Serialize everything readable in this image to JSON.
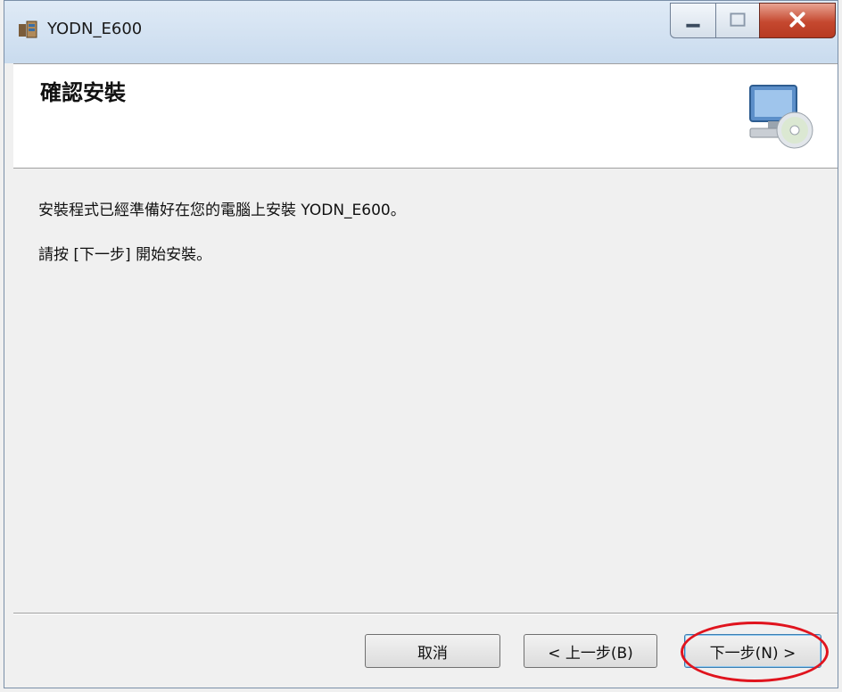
{
  "window": {
    "title": "YODN_E600"
  },
  "header": {
    "title": "確認安裝",
    "icon": "computer-cd-icon"
  },
  "content": {
    "line1": "安裝程式已經準備好在您的電腦上安裝 YODN_E600。",
    "line2": "請按 [下一步] 開始安裝。"
  },
  "buttons": {
    "cancel": "取消",
    "back": "< 上一步(B)",
    "next": "下一步(N) >"
  },
  "colors": {
    "highlight": "#e0141e",
    "close_button": "#c5482f"
  }
}
